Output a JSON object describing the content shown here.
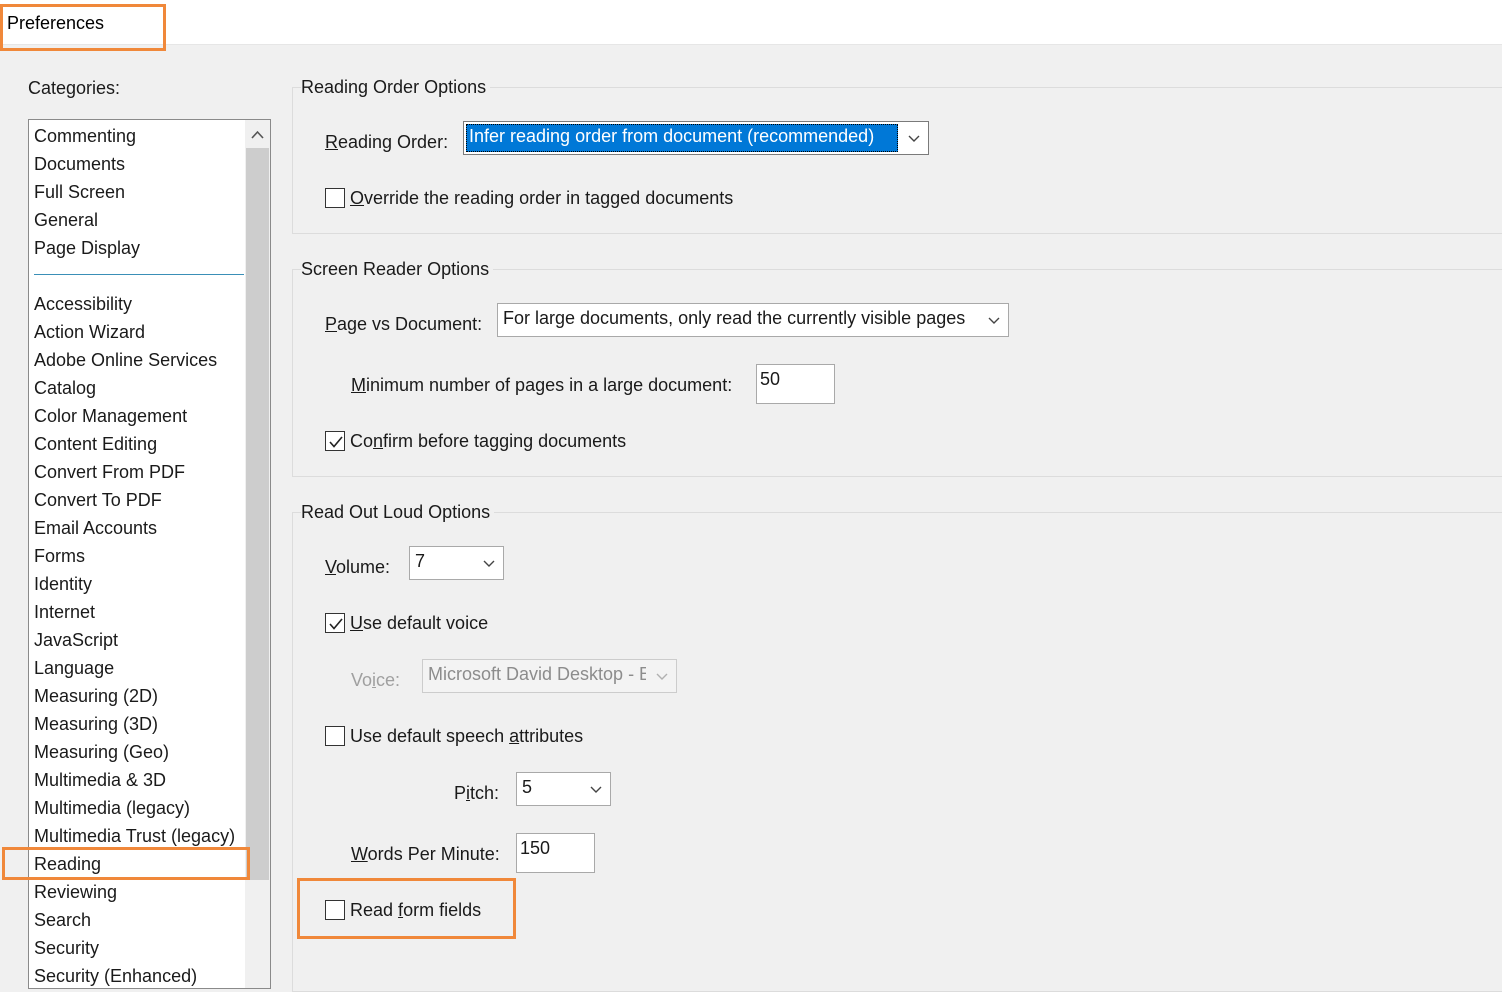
{
  "window": {
    "title": "Preferences"
  },
  "categories": {
    "label": "Categories:",
    "top_items": [
      "Commenting",
      "Documents",
      "Full Screen",
      "General",
      "Page Display"
    ],
    "items": [
      "Accessibility",
      "Action Wizard",
      "Adobe Online Services",
      "Catalog",
      "Color Management",
      "Content Editing",
      "Convert From PDF",
      "Convert To PDF",
      "Email Accounts",
      "Forms",
      "Identity",
      "Internet",
      "JavaScript",
      "Language",
      "Measuring (2D)",
      "Measuring (3D)",
      "Measuring (Geo)",
      "Multimedia & 3D",
      "Multimedia (legacy)",
      "Multimedia Trust (legacy)",
      "Reading",
      "Reviewing",
      "Search",
      "Security",
      "Security (Enhanced)"
    ],
    "selected": "Reading"
  },
  "reading_order": {
    "group_title": "Reading Order Options",
    "order_label_u": "R",
    "order_label_rest": "eading Order:",
    "order_value": "Infer reading order from document (recommended)",
    "override_u": "O",
    "override_rest": "verride the reading order in tagged documents",
    "override_checked": false
  },
  "screen_reader": {
    "group_title": "Screen Reader Options",
    "page_vs_doc_u": "P",
    "page_vs_doc_rest": "age vs Document:",
    "page_vs_doc_value": "For large documents, only read the currently visible pages",
    "min_pages_u": "M",
    "min_pages_rest": "inimum number of pages in a large document:",
    "min_pages_value": "50",
    "confirm_pre": "Co",
    "confirm_u": "n",
    "confirm_rest": "firm before tagging documents",
    "confirm_checked": true
  },
  "read_out_loud": {
    "group_title": "Read Out Loud Options",
    "volume_u": "V",
    "volume_rest": "olume:",
    "volume_value": "7",
    "default_voice_u": "U",
    "default_voice_rest": "se default voice",
    "default_voice_checked": true,
    "voice_pre": "Vo",
    "voice_u": "i",
    "voice_rest": "ce:",
    "voice_value": "Microsoft David Desktop - E",
    "speech_attr_pre": "Use default speech ",
    "speech_attr_u": "a",
    "speech_attr_rest": "ttributes",
    "speech_attr_checked": false,
    "pitch_pre": "P",
    "pitch_u": "i",
    "pitch_rest": "tch:",
    "pitch_value": "5",
    "wpm_u": "W",
    "wpm_rest": "ords Per Minute:",
    "wpm_value": "150",
    "form_fields_pre": "Read ",
    "form_fields_u": "f",
    "form_fields_rest": "orm fields",
    "form_fields_checked": false
  },
  "colors": {
    "highlight": "#f0883a",
    "selection": "#0078d7"
  }
}
